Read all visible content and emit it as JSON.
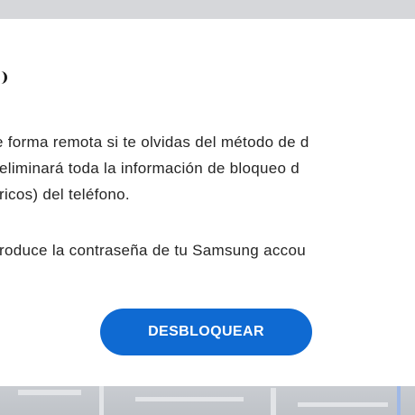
{
  "dialog": {
    "paragraph_1": {
      "line_1": "e forma remota si te olvidas del método de d",
      "line_2": " eliminará toda la información de bloqueo d",
      "line_3": "tricos) del teléfono."
    },
    "paragraph_2": {
      "line_1": "troduce la contraseña de tu Samsung accou"
    },
    "unlock_button_label": "DESBLOQUEAR"
  },
  "colors": {
    "button": "#0f6ad2",
    "text": "#252525",
    "backdrop": "#d6d7da"
  }
}
